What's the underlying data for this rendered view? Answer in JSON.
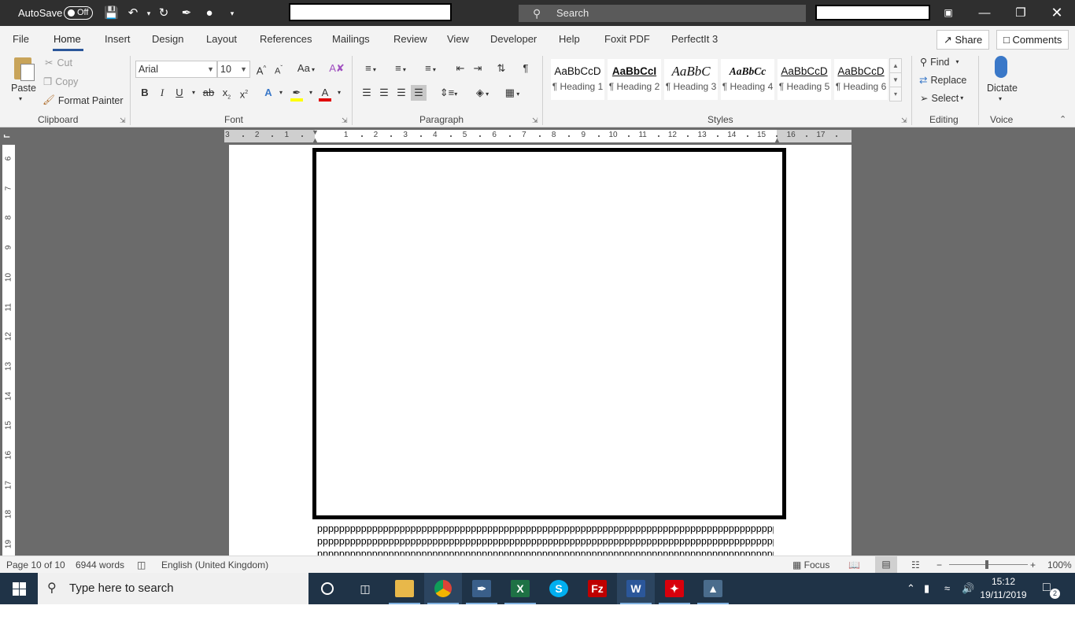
{
  "titlebar": {
    "autosave_label": "AutoSave",
    "autosave_state": "Off",
    "search_placeholder": "Search"
  },
  "menu": {
    "tabs": [
      "File",
      "Home",
      "Insert",
      "Design",
      "Layout",
      "References",
      "Mailings",
      "Review",
      "View",
      "Developer",
      "Help",
      "Foxit PDF",
      "PerfectIt 3"
    ],
    "share": "Share",
    "comments": "Comments"
  },
  "clipboard": {
    "paste": "Paste",
    "cut": "Cut",
    "copy": "Copy",
    "format_painter": "Format Painter",
    "label": "Clipboard"
  },
  "font": {
    "name": "Arial",
    "size": "10",
    "label": "Font",
    "change_case": "Aa",
    "grow": "A",
    "shrink": "A",
    "bold": "B",
    "italic": "I",
    "underline": "U",
    "strike": "ab",
    "sub": "x",
    "sup": "x",
    "effects": "A",
    "color": "A",
    "highlight_color": "#ffff00",
    "font_color": "#e00000"
  },
  "paragraph": {
    "label": "Paragraph",
    "pilcrow": "¶"
  },
  "styles": {
    "label": "Styles",
    "items": [
      {
        "preview": "AaBbCcD",
        "name": "¶ Heading 1"
      },
      {
        "preview": "AaBbCcI",
        "name": "¶ Heading 2"
      },
      {
        "preview": "AaBbC",
        "name": "¶ Heading 3"
      },
      {
        "preview": "AaBbCc",
        "name": "¶ Heading 4"
      },
      {
        "preview": "AaBbCcD",
        "name": "¶ Heading 5"
      },
      {
        "preview": "AaBbCcD",
        "name": "¶ Heading 6"
      }
    ]
  },
  "editing": {
    "find": "Find",
    "replace": "Replace",
    "select": "Select",
    "label": "Editing"
  },
  "voice": {
    "dictate": "Dictate",
    "label": "Voice"
  },
  "ruler": {
    "labels": [
      "3",
      "2",
      "1",
      "1",
      "2",
      "3",
      "4",
      "5",
      "6",
      "7",
      "8",
      "9",
      "10",
      "11",
      "12",
      "13",
      "14",
      "15",
      "16",
      "17"
    ],
    "vertical_labels": [
      "6",
      "7",
      "8",
      "9",
      "10",
      "11",
      "12",
      "13",
      "14",
      "15",
      "16",
      "17",
      "18",
      "19"
    ]
  },
  "document": {
    "lines": [
      "pppppppppppppppppppppppppppppppppppppppppppppppppppppppppppppppppppppppppppppppppppppppp",
      "pppppppppppppppppppppppppppppppppppppppppppppppppppppppppppppppppppppppppppppppppppppppp",
      "pppppppppppppppppppppppppppppppppppppppppppppppppppppppppppppppppppppppppppppppppppppppp"
    ]
  },
  "status": {
    "page": "Page 10 of 10",
    "words": "6944 words",
    "language": "English (United Kingdom)",
    "focus": "Focus",
    "zoom": "100%"
  },
  "taskbar": {
    "search_placeholder": "Type here to search",
    "time": "15:12",
    "date": "19/11/2019",
    "notifications": "2"
  }
}
